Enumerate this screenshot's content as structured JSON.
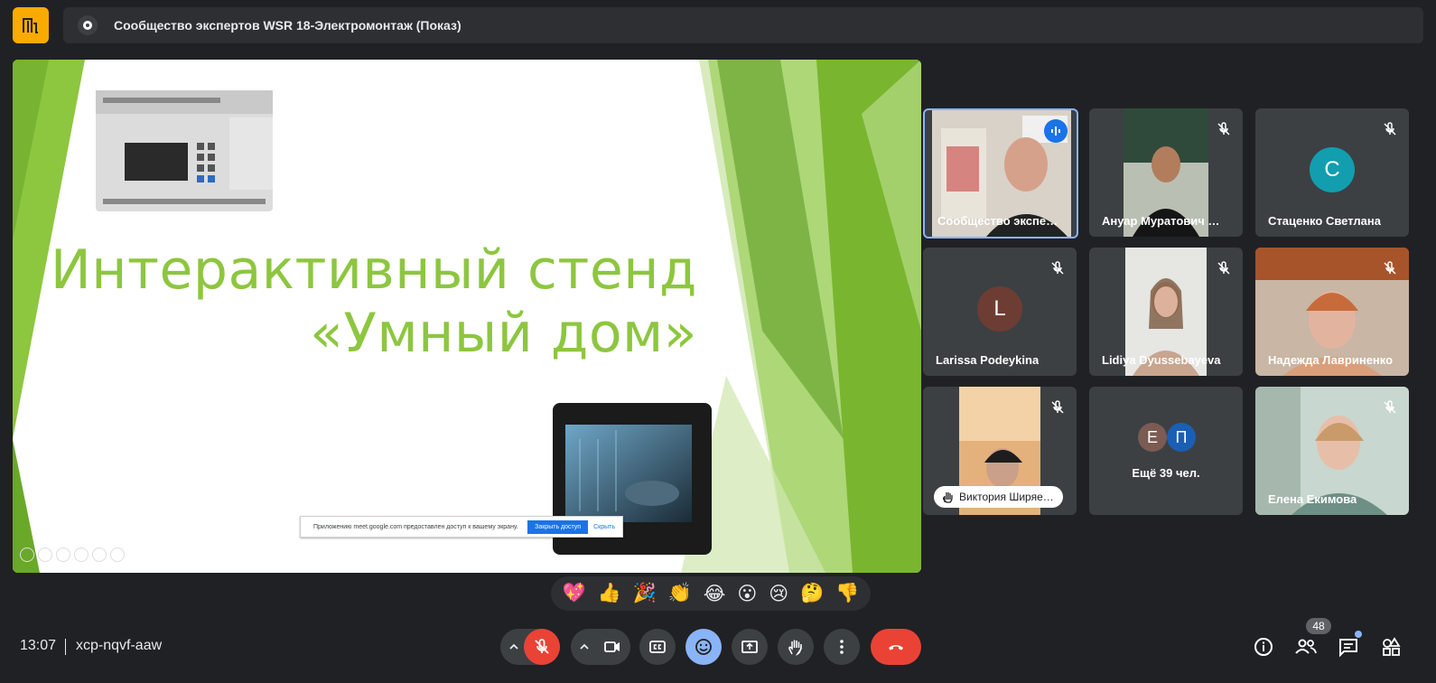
{
  "meeting": {
    "title": "Сообщество экспертов WSR 18-Электромонтаж (Показ)",
    "time": "13:07",
    "code": "xcp-nqvf-aaw"
  },
  "slide": {
    "title_line1": "Интерактивный стенд",
    "title_line2": "«Умный дом»",
    "share_notice": "Приложению meet.google.com предоставлен доступ к вашему экрану.",
    "stop_sharing_label": "Закрыть доступ",
    "hide_label": "Скрыть",
    "accent_color": "#8dc63f"
  },
  "participants": [
    {
      "name": "Сообщество экспе…",
      "state": "speaking"
    },
    {
      "name": "Ануар Муратович …",
      "state": "muted"
    },
    {
      "name": "Стаценко Светлана",
      "initial": "С",
      "avatar_color": "#129eaf",
      "state": "muted"
    },
    {
      "name": "Larissa Podeykina",
      "initial": "L",
      "avatar_color": "#6d3d33",
      "state": "muted"
    },
    {
      "name": "Lidiya Dyussebayeva",
      "state": "muted"
    },
    {
      "name": "Надежда Лавриненко",
      "state": "muted"
    },
    {
      "name": "Виктория Ширяе…",
      "state": "muted"
    },
    {
      "name": "Ещё 39 чел.",
      "initials": [
        "Е",
        "П"
      ],
      "avatar_colors": [
        "#7b5b52",
        "#1a5fb4"
      ]
    },
    {
      "name": "Елена Екимова",
      "state": "muted"
    }
  ],
  "reactions": [
    "💖",
    "👍",
    "🎉",
    "👏",
    "😂",
    "😮",
    "😢",
    "🤔",
    "👎"
  ],
  "people_count": "48",
  "icons": {
    "mic": "mic-off-icon",
    "camera": "videocam-icon",
    "captions": "closed-caption-icon",
    "reactions": "emoji-icon",
    "present": "present-to-all-icon",
    "hand": "raise-hand-icon",
    "more": "more-vert-icon",
    "leave": "call-end-icon",
    "info": "info-icon",
    "people": "people-icon",
    "chat": "chat-icon",
    "activities": "activities-icon"
  }
}
